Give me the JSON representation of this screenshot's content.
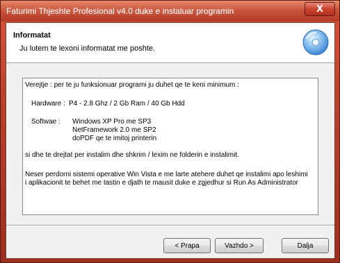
{
  "window": {
    "title": "Faturimi Thjeshte Profesional v4.0 duke e instaluar programin",
    "close_glyph": "X"
  },
  "header": {
    "title": "Informatat",
    "subtitle": "Ju lutem te lexoni informatat me poshte.",
    "icon": "cd-disc-icon"
  },
  "content": {
    "requirements_heading": "Verejtje : per te ju funksionuar programi ju duhet qe te keni minimum :",
    "hardware_label": "Hardware :",
    "hardware_value": "P4 - 2.8 Ghz / 2 Gb Ram / 40 Gb Hdd",
    "software_label": "Softwae   :",
    "software_items": [
      "Windows XP Pro me SP3",
      "NetFramework 2.0 me SP2",
      "doPDF qe te imitoj printerin"
    ],
    "rights_note": "si dhe te drejtat per instalim dhe shkrim / lexim ne folderin e instalimit.",
    "vista_note_line1": "Neser perdorni sistemi operative Win Vista e me larte atehere duhet qe instalimi apo leshimi",
    "vista_note_line2": "i aplikacionit te behet me tastin e djath te mausit duke e zgjedhur si Run As Administrator"
  },
  "buttons": {
    "back": "< Prapa",
    "next": "Vazhdo >",
    "cancel": "Dalja"
  },
  "colors": {
    "title_bar": "#c9543a",
    "frame": "#b9402c",
    "close_button": "#c7432c"
  }
}
